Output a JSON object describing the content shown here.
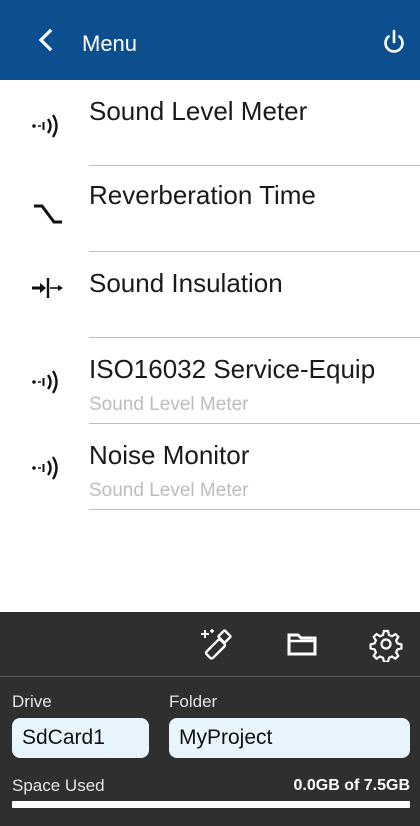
{
  "header": {
    "title": "Menu",
    "back_icon": "chevron-left-icon",
    "power_icon": "power-icon",
    "background": "#0b4f8e"
  },
  "menu": {
    "items": [
      {
        "title": "Sound Level Meter",
        "subtitle": "",
        "icon": "sound-wave-icon"
      },
      {
        "title": "Reverberation Time",
        "subtitle": "",
        "icon": "decay-curve-icon"
      },
      {
        "title": "Sound Insulation",
        "subtitle": "",
        "icon": "insulation-arrows-icon"
      },
      {
        "title": "ISO16032 Service-Equip",
        "subtitle": "Sound Level Meter",
        "icon": "sound-wave-icon"
      },
      {
        "title": "Noise Monitor",
        "subtitle": "Sound Level Meter",
        "icon": "sound-wave-icon"
      }
    ]
  },
  "footer": {
    "toolbar": {
      "calibrate_icon": "calibration-wand-icon",
      "folder_icon": "folder-icon",
      "settings_icon": "gear-icon"
    },
    "drive_label": "Drive",
    "drive_value": "SdCard1",
    "folder_label": "Folder",
    "folder_value": "MyProject",
    "space_label": "Space Used",
    "space_value": "0.0GB of 7.5GB",
    "space_used_fraction": 0.0
  }
}
